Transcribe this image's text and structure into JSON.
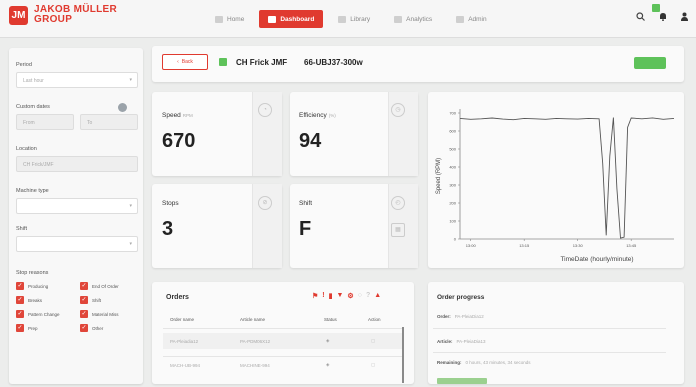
{
  "brand": {
    "line1": "JAKOB MÜLLER",
    "line2": "GROUP"
  },
  "nav": {
    "tabs": [
      {
        "label": "Home",
        "active": false
      },
      {
        "label": "Dashboard",
        "active": true
      },
      {
        "label": "Library",
        "active": false
      },
      {
        "label": "Analytics",
        "active": false
      },
      {
        "label": "Admin",
        "active": false
      }
    ]
  },
  "sidebar": {
    "period_label": "Period",
    "period_value": "Last hour",
    "custom_dates_label": "Custom dates",
    "from_placeholder": "From",
    "to_placeholder": "To",
    "location_label": "Location",
    "location_value": "CH Frick/JMF",
    "machine_type_label": "Machine type",
    "shift_label": "Shift",
    "stop_reasons_label": "Stop reasons",
    "stop_reasons": [
      "Producing",
      "End Of Order",
      "Breaks",
      "Shift",
      "Pattern Change",
      "Material Miss",
      "Prep",
      "Other"
    ]
  },
  "header": {
    "back_label": "Back",
    "machine_location": "CH Frick JMF",
    "machine_id": "66-UBJ37-300w"
  },
  "kpis": [
    {
      "name": "speed",
      "title": "Speed",
      "unit": "RPM",
      "value": "670"
    },
    {
      "name": "efficiency",
      "title": "Efficiency",
      "unit": "(%)",
      "value": "94"
    },
    {
      "name": "stops",
      "title": "Stops",
      "unit": "",
      "value": "3"
    },
    {
      "name": "shift",
      "title": "Shift",
      "unit": "",
      "value": "F"
    }
  ],
  "chart_data": {
    "type": "line",
    "title": "",
    "xlabel": "TimeDate (hourly/minute)",
    "ylabel": "Speed (RPM)",
    "x_ticks": [
      "13:00",
      "13:15",
      "13:30",
      "13:45"
    ],
    "y_ticks": [
      "0",
      "100",
      "200",
      "300",
      "400",
      "500",
      "600",
      "700"
    ],
    "ylim": [
      0,
      700
    ],
    "x": [
      0,
      3,
      6,
      9,
      12,
      15,
      18,
      21,
      24,
      27,
      30,
      33,
      36,
      39,
      40,
      41,
      42,
      43,
      44,
      45,
      46,
      47,
      48,
      51,
      54,
      57,
      60
    ],
    "series": [
      {
        "name": "",
        "values": [
          670,
          665,
          668,
          672,
          666,
          663,
          670,
          668,
          665,
          670,
          668,
          666,
          670,
          668,
          420,
          20,
          460,
          675,
          280,
          5,
          10,
          620,
          672,
          668,
          673,
          665,
          670
        ]
      }
    ],
    "grid": false,
    "legend": "none"
  },
  "orders": {
    "title": "Orders",
    "columns": [
      "Order name",
      "Article name",
      "Status",
      "Action"
    ],
    "rows": [
      {
        "order": "PA-Pleiadia12",
        "article": "PA-PDM06X12",
        "status": "",
        "action": ""
      },
      {
        "order": "MACH-UB-994",
        "article": "MACHINE-994",
        "status": "",
        "action": ""
      }
    ]
  },
  "order_progress": {
    "title": "Order progress",
    "order_label": "Order:",
    "order_value": "PA-PleiaDia12",
    "article_label": "Article:",
    "article_value": "PA-PleiaDia13",
    "remaining_label": "Remaining:",
    "remaining_value": "0 hours, 43 minutes, 34 seconds"
  },
  "colors": {
    "accent": "#e03a2f",
    "running": "#5ec25a"
  }
}
